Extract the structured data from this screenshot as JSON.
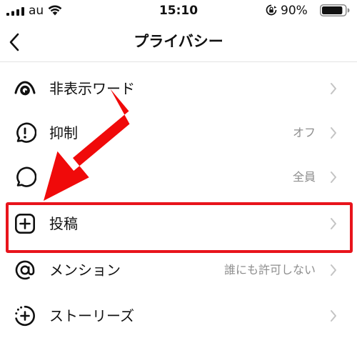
{
  "status_bar": {
    "carrier": "au",
    "time": "15:10",
    "battery_percent": "90%",
    "battery_level": 0.9,
    "icons": [
      "signal-icon",
      "wifi-icon",
      "orientation-lock-icon",
      "battery-icon"
    ]
  },
  "nav": {
    "title": "プライバシー",
    "back_icon": "chevron-left-icon"
  },
  "rows": [
    {
      "label": "非表示ワード",
      "value": "",
      "icon": "hidden-words-icon"
    },
    {
      "label": "抑制",
      "value": "オフ",
      "icon": "restrict-icon"
    },
    {
      "label": "コ",
      "value": "全員",
      "icon": "comment-icon"
    },
    {
      "label": "投稿",
      "value": "",
      "icon": "add-post-icon"
    },
    {
      "label": "メンション",
      "value": "誰にも許可しない",
      "icon": "mention-icon"
    },
    {
      "label": "ストーリーズ",
      "value": "",
      "icon": "add-story-icon"
    }
  ],
  "annotation": {
    "highlighted_row": "投稿",
    "highlight_color": "#e8141c",
    "arrow_color": "#f00a0a"
  }
}
